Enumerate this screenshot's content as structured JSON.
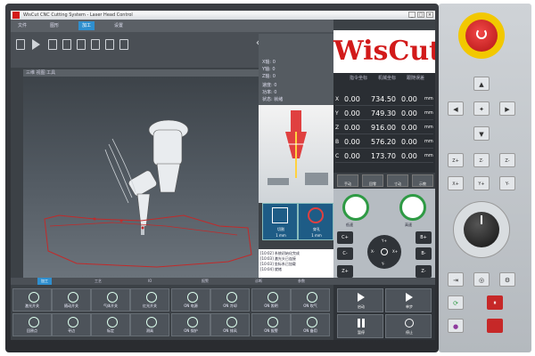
{
  "window": {
    "title": "WisCut CNC Cutting System - Laser Head Control",
    "controls": [
      "_",
      "□",
      "×"
    ]
  },
  "menu": {
    "tabs": [
      {
        "label": "文件"
      },
      {
        "label": "图形"
      },
      {
        "label": "加工"
      },
      {
        "label": "设置"
      }
    ]
  },
  "toolbar": {
    "icons": [
      "open-icon",
      "play-icon",
      "edit-icon",
      "layers-icon",
      "export-icon",
      "settings-icon",
      "zoom-icon",
      "list-icon"
    ]
  },
  "viewport": {
    "header": "三维  视图  工具"
  },
  "side_panel": {
    "rows": [
      {
        "label": "X轴:  0"
      },
      {
        "label": "Y轴:  0"
      },
      {
        "label": "Z轴:  0"
      },
      {
        "label": "速度: 0"
      },
      {
        "label": "功率: 0"
      },
      {
        "label": "状态: 就绪"
      }
    ],
    "mode_buttons": [
      {
        "label": "切割",
        "sub": "1 mm"
      },
      {
        "label": "穿孔",
        "sub": "1 mm"
      }
    ]
  },
  "messages": [
    "[10:02] 系统初始化完成",
    "[10:03] 激光头已连接",
    "[10:03] 坐标系已加载",
    "[10:04] 就绪"
  ],
  "brand": {
    "text": "WisCut"
  },
  "axes": {
    "headers": [
      "",
      "指令坐标",
      "机械坐标",
      "跟随误差"
    ],
    "rows": [
      {
        "axis": "X",
        "cmd": "0.00",
        "mach": "734.50",
        "err": "0.00",
        "unit": "mm"
      },
      {
        "axis": "Y",
        "cmd": "0.00",
        "mach": "749.30",
        "err": "0.00",
        "unit": "mm"
      },
      {
        "axis": "Z",
        "cmd": "0.00",
        "mach": "916.00",
        "err": "0.00",
        "unit": "mm"
      },
      {
        "axis": "B",
        "cmd": "0.00",
        "mach": "576.20",
        "err": "0.00",
        "unit": "mm"
      },
      {
        "axis": "C",
        "cmd": "0.00",
        "mach": "173.70",
        "err": "0.00",
        "unit": "mm"
      }
    ],
    "buttons": [
      {
        "label": "手动"
      },
      {
        "label": "回零"
      },
      {
        "label": "寸动"
      },
      {
        "label": "示教"
      }
    ]
  },
  "jog": {
    "buttons": [
      {
        "label": "C+"
      },
      {
        "label": "C-"
      },
      {
        "label": "B+"
      },
      {
        "label": "B-"
      },
      {
        "label": "Z+"
      },
      {
        "label": "Z-"
      },
      {
        "label": "X-"
      },
      {
        "label": "X+"
      },
      {
        "label": "Y+"
      },
      {
        "label": "Y-"
      }
    ],
    "speed_labels": [
      "低速",
      "高速"
    ]
  },
  "bottom_tabs": [
    {
      "label": "加工",
      "active": true
    },
    {
      "label": "工艺"
    },
    {
      "label": "IO"
    },
    {
      "label": "报警"
    },
    {
      "label": "诊断"
    },
    {
      "label": "参数"
    }
  ],
  "bottom_cells": [
    {
      "label": "激光开关"
    },
    {
      "label": "随动开关"
    },
    {
      "label": "气体开关"
    },
    {
      "label": "红光开关"
    },
    {
      "label": "ON 电源"
    },
    {
      "label": "ON 冷却"
    },
    {
      "label": "ON 照明"
    },
    {
      "label": "ON 吹气"
    },
    {
      "label": "回原点"
    },
    {
      "label": "寻边"
    },
    {
      "label": "标定"
    },
    {
      "label": "测高"
    },
    {
      "label": "ON 保护"
    },
    {
      "label": "ON 排风"
    },
    {
      "label": "ON 报警"
    },
    {
      "label": "ON 备用"
    }
  ],
  "run": {
    "buttons": [
      {
        "label": "启动"
      },
      {
        "label": "单步"
      },
      {
        "label": "暂停"
      },
      {
        "label": "停止"
      }
    ]
  },
  "hardware": {
    "keys_axes": [
      {
        "label": "▲"
      },
      {
        "label": "◀"
      },
      {
        "label": "✦"
      },
      {
        "label": "▶"
      },
      {
        "label": "▼"
      }
    ],
    "keys_jog": [
      "Z+",
      "Z·",
      "Z-",
      "X+",
      "Y+",
      "Y-"
    ],
    "bottom_keys": [
      "⇥",
      "◎",
      "⚙",
      "⟳",
      "⏸",
      "●"
    ]
  },
  "colors": {
    "accent": "#2f8fcf",
    "brand_red": "#d21a1a",
    "panel_dark": "#3c4146",
    "estop_yellow": "#f2c800"
  }
}
